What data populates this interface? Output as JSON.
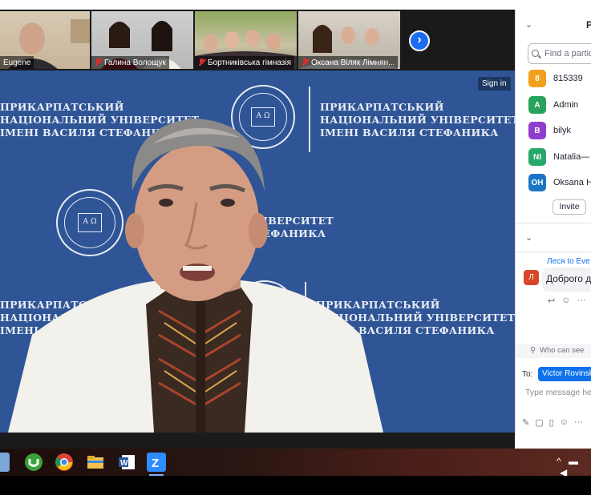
{
  "thumbnails": [
    {
      "name": "Eugene",
      "muted": false
    },
    {
      "name": "Галина Волощук",
      "muted": true
    },
    {
      "name": "Бортниківська гімназія",
      "muted": true
    },
    {
      "name": "Оксана Віляк Лімнян...",
      "muted": true
    }
  ],
  "main_video": {
    "sign_in_label": "Sign in",
    "banner_line1": "ПРИКАРПАТСЬКИЙ",
    "banner_line2": "НАЦІОНАЛЬНИЙ УНІВЕРСИТЕТ",
    "banner_line3": "ІМЕНІ ВАСИЛЯ СТЕФАНИКА",
    "banner_partial2": "НИВЕРСИТЕТ",
    "banner_partial3": "ТЕФАНИКА",
    "seal_text": "А Ω"
  },
  "participants_panel": {
    "title": "Pa",
    "search_placeholder": "Find a partic",
    "participants": [
      {
        "initials": "8",
        "name": "815339",
        "color": "#f0a01a"
      },
      {
        "initials": "A",
        "name": "Admin",
        "color": "#27a35a"
      },
      {
        "initials": "B",
        "name": "bilyk",
        "color": "#8e3fcf"
      },
      {
        "initials": "NI",
        "name": "Natalia—",
        "color": "#26a86b"
      },
      {
        "initials": "OH",
        "name": "Oksana Hl",
        "color": "#1b75c4"
      }
    ],
    "invite_label": "Invite"
  },
  "chat_panel": {
    "from": "Леся to Eve",
    "sender_initial": "Л",
    "message": "Доброго д",
    "who_can_see": "Who can see",
    "to_label": "To:",
    "recipient": "Victor Rovinski",
    "input_placeholder": "Type message her"
  },
  "colors": {
    "video_bg": "#2f5596",
    "accent": "#0e72ed",
    "taskbar": "#2a1612"
  }
}
